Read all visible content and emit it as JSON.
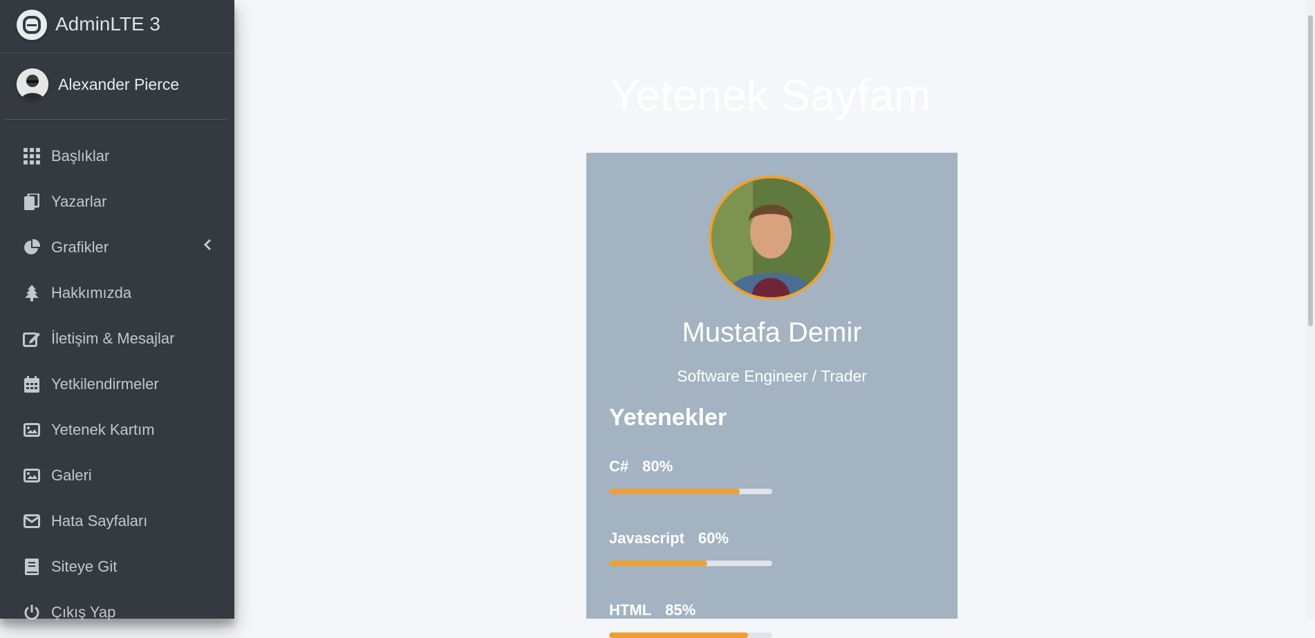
{
  "brand": {
    "name": "AdminLTE 3"
  },
  "user": {
    "name": "Alexander Pierce"
  },
  "sidebar": {
    "items": [
      {
        "label": "Başlıklar",
        "icon": "grid-icon"
      },
      {
        "label": "Yazarlar",
        "icon": "copy-icon"
      },
      {
        "label": "Grafikler",
        "icon": "pie-chart-icon"
      },
      {
        "label": "Hakkımızda",
        "icon": "tree-icon"
      },
      {
        "label": "İletişim & Mesajlar",
        "icon": "edit-icon"
      },
      {
        "label": "Yetkilendirmeler",
        "icon": "calendar-icon"
      },
      {
        "label": "Yetenek Kartım",
        "icon": "image-icon"
      },
      {
        "label": "Galeri",
        "icon": "image-icon"
      },
      {
        "label": "Hata Sayfaları",
        "icon": "envelope-icon"
      },
      {
        "label": "Siteye Git",
        "icon": "book-icon"
      },
      {
        "label": "Çıkış Yap",
        "icon": "power-icon"
      }
    ]
  },
  "page": {
    "title": "Yetenek Sayfam"
  },
  "profile": {
    "name": "Mustafa Demir",
    "title": "Software Engineer / Trader",
    "skills_heading": "Yetenekler",
    "skills": [
      {
        "name": "C#",
        "percent_label": "80%",
        "percent": 80
      },
      {
        "name": "Javascript",
        "percent_label": "60%",
        "percent": 60
      },
      {
        "name": "HTML",
        "percent_label": "85%",
        "percent": 85
      }
    ]
  },
  "colors": {
    "sidebar_bg": "#343a40",
    "content_bg": "#f4f6f9",
    "card_bg": "#a3b3c1",
    "accent": "#f0a02f"
  }
}
